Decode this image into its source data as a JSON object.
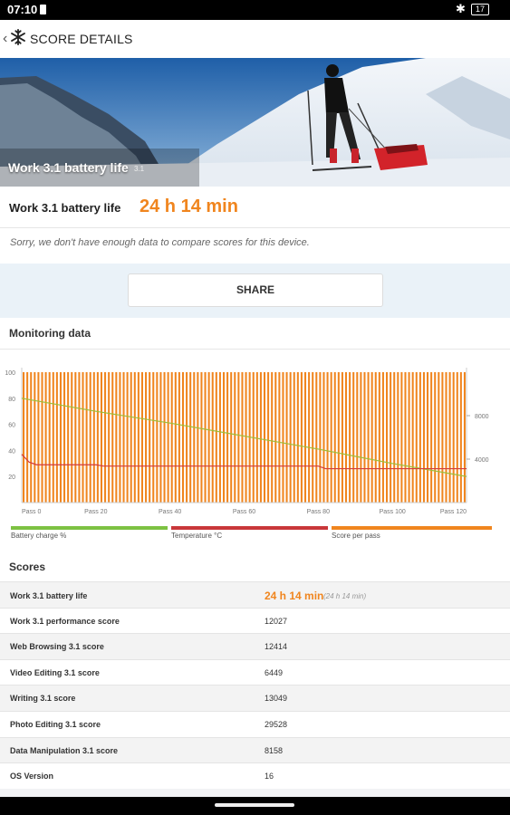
{
  "status": {
    "time": "07:10",
    "battery": "17"
  },
  "appbar": {
    "title": "SCORE DETAILS"
  },
  "hero": {
    "title": "Work 3.1 battery life",
    "version": "3.1"
  },
  "result": {
    "name": "Work 3.1 battery life",
    "value": "24 h 14 min",
    "note": "Sorry, we don't have enough data to compare scores for this device."
  },
  "share_label": "SHARE",
  "monitoring": {
    "title": "Monitoring data",
    "legend": [
      {
        "label": "Battery charge %",
        "color": "#7dc242"
      },
      {
        "label": "Temperature °C",
        "color": "#c9373a"
      },
      {
        "label": "Score per pass",
        "color": "#f0851e"
      }
    ]
  },
  "chart_data": {
    "type": "bar",
    "x_tick_labels": [
      "Pass 0",
      "Pass 20",
      "Pass 40",
      "Pass 60",
      "Pass 80",
      "Pass 100",
      "Pass 120"
    ],
    "left_tick_labels": [
      "100",
      "80",
      "60",
      "40",
      "20"
    ],
    "right_tick_labels": [
      "8000",
      "4000"
    ],
    "xlim": [
      0,
      120
    ],
    "ylim_left": [
      0,
      100
    ],
    "ylim_right": [
      0,
      12000
    ],
    "series": [
      {
        "name": "Battery charge %",
        "type": "line",
        "axis": "left",
        "color": "#9dbe3a",
        "x": [
          0,
          20,
          40,
          60,
          80,
          100,
          120
        ],
        "values": [
          80,
          70,
          61,
          51,
          41,
          30,
          20
        ]
      },
      {
        "name": "Temperature °C",
        "type": "line",
        "axis": "left",
        "color": "#d23c3c",
        "x": [
          0,
          2,
          4,
          20,
          22,
          40,
          60,
          80,
          82,
          100,
          120
        ],
        "values": [
          37,
          31,
          29,
          29,
          28,
          28,
          28,
          28,
          26,
          26,
          26
        ]
      },
      {
        "name": "Score per pass",
        "type": "bar",
        "axis": "right",
        "color": "#f0851e",
        "count": 120,
        "value": 12000
      }
    ]
  },
  "scores": {
    "title": "Scores",
    "rows": [
      {
        "label": "Work 3.1 battery life",
        "value": "24 h 14 min",
        "sub": "(24 h 14 min)"
      },
      {
        "label": "Work 3.1 performance score",
        "value": "12027"
      },
      {
        "label": "Web Browsing 3.1 score",
        "value": "12414"
      },
      {
        "label": "Video Editing 3.1 score",
        "value": "6449"
      },
      {
        "label": "Writing 3.1 score",
        "value": "13049"
      },
      {
        "label": "Photo Editing 3.1 score",
        "value": "29528"
      },
      {
        "label": "Data Manipulation 3.1 score",
        "value": "8158"
      },
      {
        "label": "OS Version",
        "value": "16"
      }
    ]
  }
}
